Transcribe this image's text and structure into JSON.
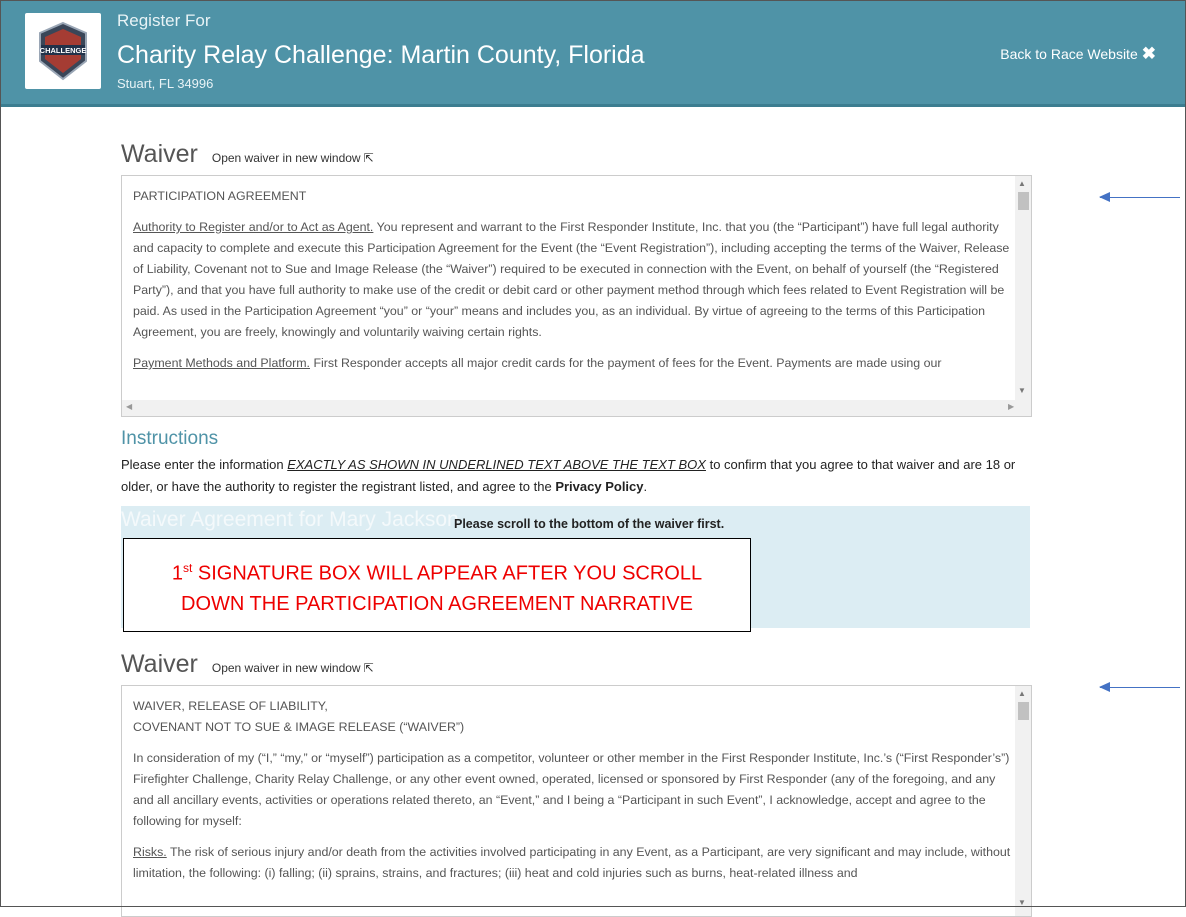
{
  "header": {
    "pre_title": "Register For",
    "title": "Charity Relay Challenge: Martin County, Florida",
    "location": "Stuart, FL 34996",
    "back_label": "Back to Race Website",
    "logo_text": "CHALLENGE",
    "accent_color": "#4f93a7"
  },
  "waiver1": {
    "title": "Waiver",
    "open_link": "Open waiver in new window",
    "heading": "PARTICIPATION AGREEMENT",
    "p1_label": "Authority to Register and/or to Act as Agent.",
    "p1_text": " You represent and warrant to the First Responder Institute, Inc. that you (the “Participant”) have full legal authority and capacity to complete and execute this Participation Agreement for the Event (the “Event Registration”), including accepting the terms of the Waiver, Release of Liability, Covenant not to Sue and Image Release (the “Waiver”) required to be executed in connection with the Event, on behalf of yourself (the “Registered Party”), and that you have full authority to make use of the credit or debit card or other payment method through which fees related to Event Registration will be paid. As used in the Participation Agreement “you” or “your” means and includes you, as an individual. By virtue of agreeing to the terms of this Participation Agreement, you are freely, knowingly and voluntarily waiving certain rights.",
    "p2_label": "Payment Methods and Platform.",
    "p2_text": " First Responder accepts all major credit cards for the payment of fees for the Event. Payments are made using our"
  },
  "instructions": {
    "title": "Instructions",
    "text_before": "Please enter the information ",
    "emphasis": "EXACTLY AS SHOWN IN UNDERLINED TEXT ABOVE THE TEXT BOX",
    "text_after": " to confirm that you agree to that waiver and are 18 or older, or have the authority to register the registrant listed, and agree to the ",
    "privacy": "Privacy Policy",
    "period": "."
  },
  "agreement": {
    "title": "Waiver Agreement for Mary Jackson",
    "scroll_note": "Please scroll to the bottom of the waiver first."
  },
  "callout": {
    "line1_pre": "1",
    "line1_sup": "st",
    "line1_post": " SIGNATURE BOX WILL APPEAR AFTER YOU SCROLL",
    "line2": "DOWN THE PARTICIPATION AGREEMENT NARRATIVE",
    "color": "#ee0000"
  },
  "waiver2": {
    "title": "Waiver",
    "open_link": "Open waiver in new window",
    "heading1": "WAIVER, RELEASE OF LIABILITY,",
    "heading2": "COVENANT NOT TO SUE & IMAGE RELEASE (“WAIVER”)",
    "p1": "In consideration of my (“I,” “my,” or “myself”) participation as a competitor, volunteer or other member in the First Responder Institute, Inc.’s (“First Responder’s”) Firefighter Challenge, Charity Relay Challenge, or any other event owned, operated, licensed or sponsored by First Responder (any of the foregoing, and any and all ancillary events, activities or operations related thereto, an “Event,” and I being a “Participant in such Event”, I acknowledge, accept and agree to the following for myself:",
    "p2_label": "Risks.",
    "p2_text": " The risk of serious injury and/or death from the activities involved participating in any Event, as a Participant, are very significant and may include, without limitation, the following: (i) falling; (ii) sprains, strains, and fractures; (iii) heat and cold injuries such as burns, heat-related illness and"
  }
}
